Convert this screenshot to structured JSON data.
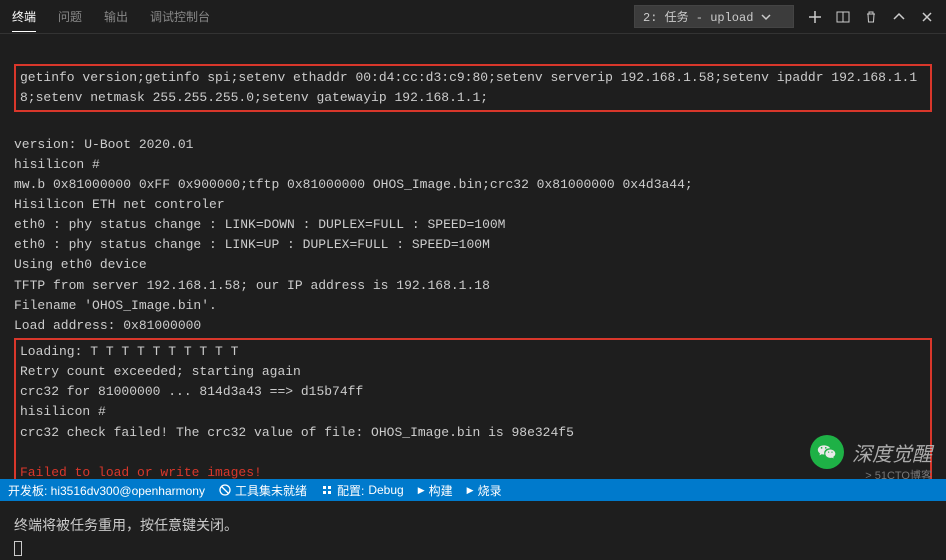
{
  "header": {
    "tabs": [
      "终端",
      "问题",
      "输出",
      "调试控制台"
    ],
    "active_tab": 0,
    "task_select": "2: 任务 - upload"
  },
  "terminal": {
    "box1": "getinfo version;getinfo spi;setenv ethaddr 00:d4:cc:d3:c9:80;setenv serverip 192.168.1.58;setenv ipaddr 192.168.1.18;setenv netmask 255.255.255.0;setenv gatewayip 192.168.1.1;",
    "mid": "version: U-Boot 2020.01\nhisilicon #\nmw.b 0x81000000 0xFF 0x900000;tftp 0x81000000 OHOS_Image.bin;crc32 0x81000000 0x4d3a44;\nHisilicon ETH net controler\neth0 : phy status change : LINK=DOWN : DUPLEX=FULL : SPEED=100M\neth0 : phy status change : LINK=UP : DUPLEX=FULL : SPEED=100M\nUsing eth0 device\nTFTP from server 192.168.1.58; our IP address is 192.168.1.18\nFilename 'OHOS_Image.bin'.\nLoad address: 0x81000000",
    "box2_lines": "Loading: T T T T T T T T T T\nRetry count exceeded; starting again\ncrc32 for 81000000 ... 814d3a43 ==> d15b74ff\nhisilicon #\ncrc32 check failed! The crc32 value of file: OHOS_Image.bin is 98e324f5",
    "box2_error": "Failed to load or write images!",
    "closing_msg": "终端将被任务重用，按任意键关闭。"
  },
  "statusbar": {
    "board": "开发板: hi3516dv300@openharmony",
    "toolset": "工具集未就绪",
    "config_label": "配置:",
    "config_value": "Debug",
    "build": "构建",
    "burn": "烧录"
  },
  "watermark": {
    "text": "深度觉醒",
    "sub": "> 51CTO博客"
  }
}
